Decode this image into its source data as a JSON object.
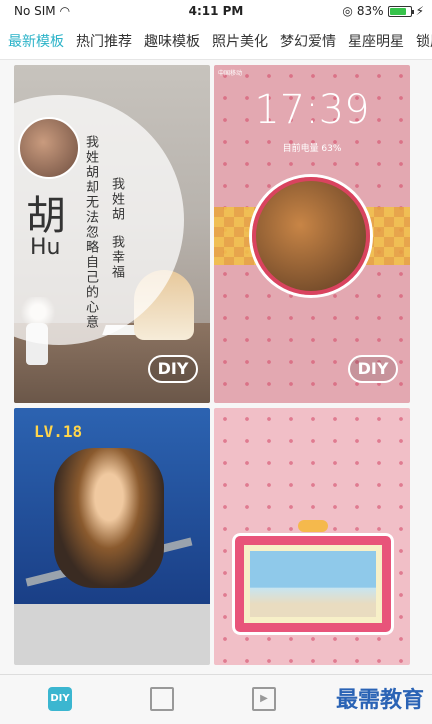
{
  "status_bar": {
    "carrier": "No SIM",
    "time": "4:11 PM",
    "battery_percent": "83%",
    "battery_level": 0.83
  },
  "tabs": [
    {
      "label": "最新模板",
      "active": true
    },
    {
      "label": "热门推荐",
      "active": false
    },
    {
      "label": "趣味模板",
      "active": false
    },
    {
      "label": "照片美化",
      "active": false
    },
    {
      "label": "梦幻爱情",
      "active": false
    },
    {
      "label": "星座明星",
      "active": false
    },
    {
      "label": "锁屏",
      "active": false
    }
  ],
  "cards": {
    "card1": {
      "big_char": "胡",
      "pinyin": "Hu",
      "vertical_1": "我姓胡却无法忽略自己的心意",
      "vertical_2": "我姓胡",
      "vertical_3": "我幸福",
      "diy": "DIY"
    },
    "card2": {
      "status_small": "中国移动",
      "clock": "17:39",
      "power": "目前电量 63%",
      "diy": "DIY"
    },
    "card3": {
      "level": "LV.18"
    }
  },
  "bottom_nav": {
    "diy_label": "DIY",
    "watermark": "最需教育"
  },
  "colors": {
    "accent": "#2cb3c8",
    "watermark": "#2a63b5"
  }
}
